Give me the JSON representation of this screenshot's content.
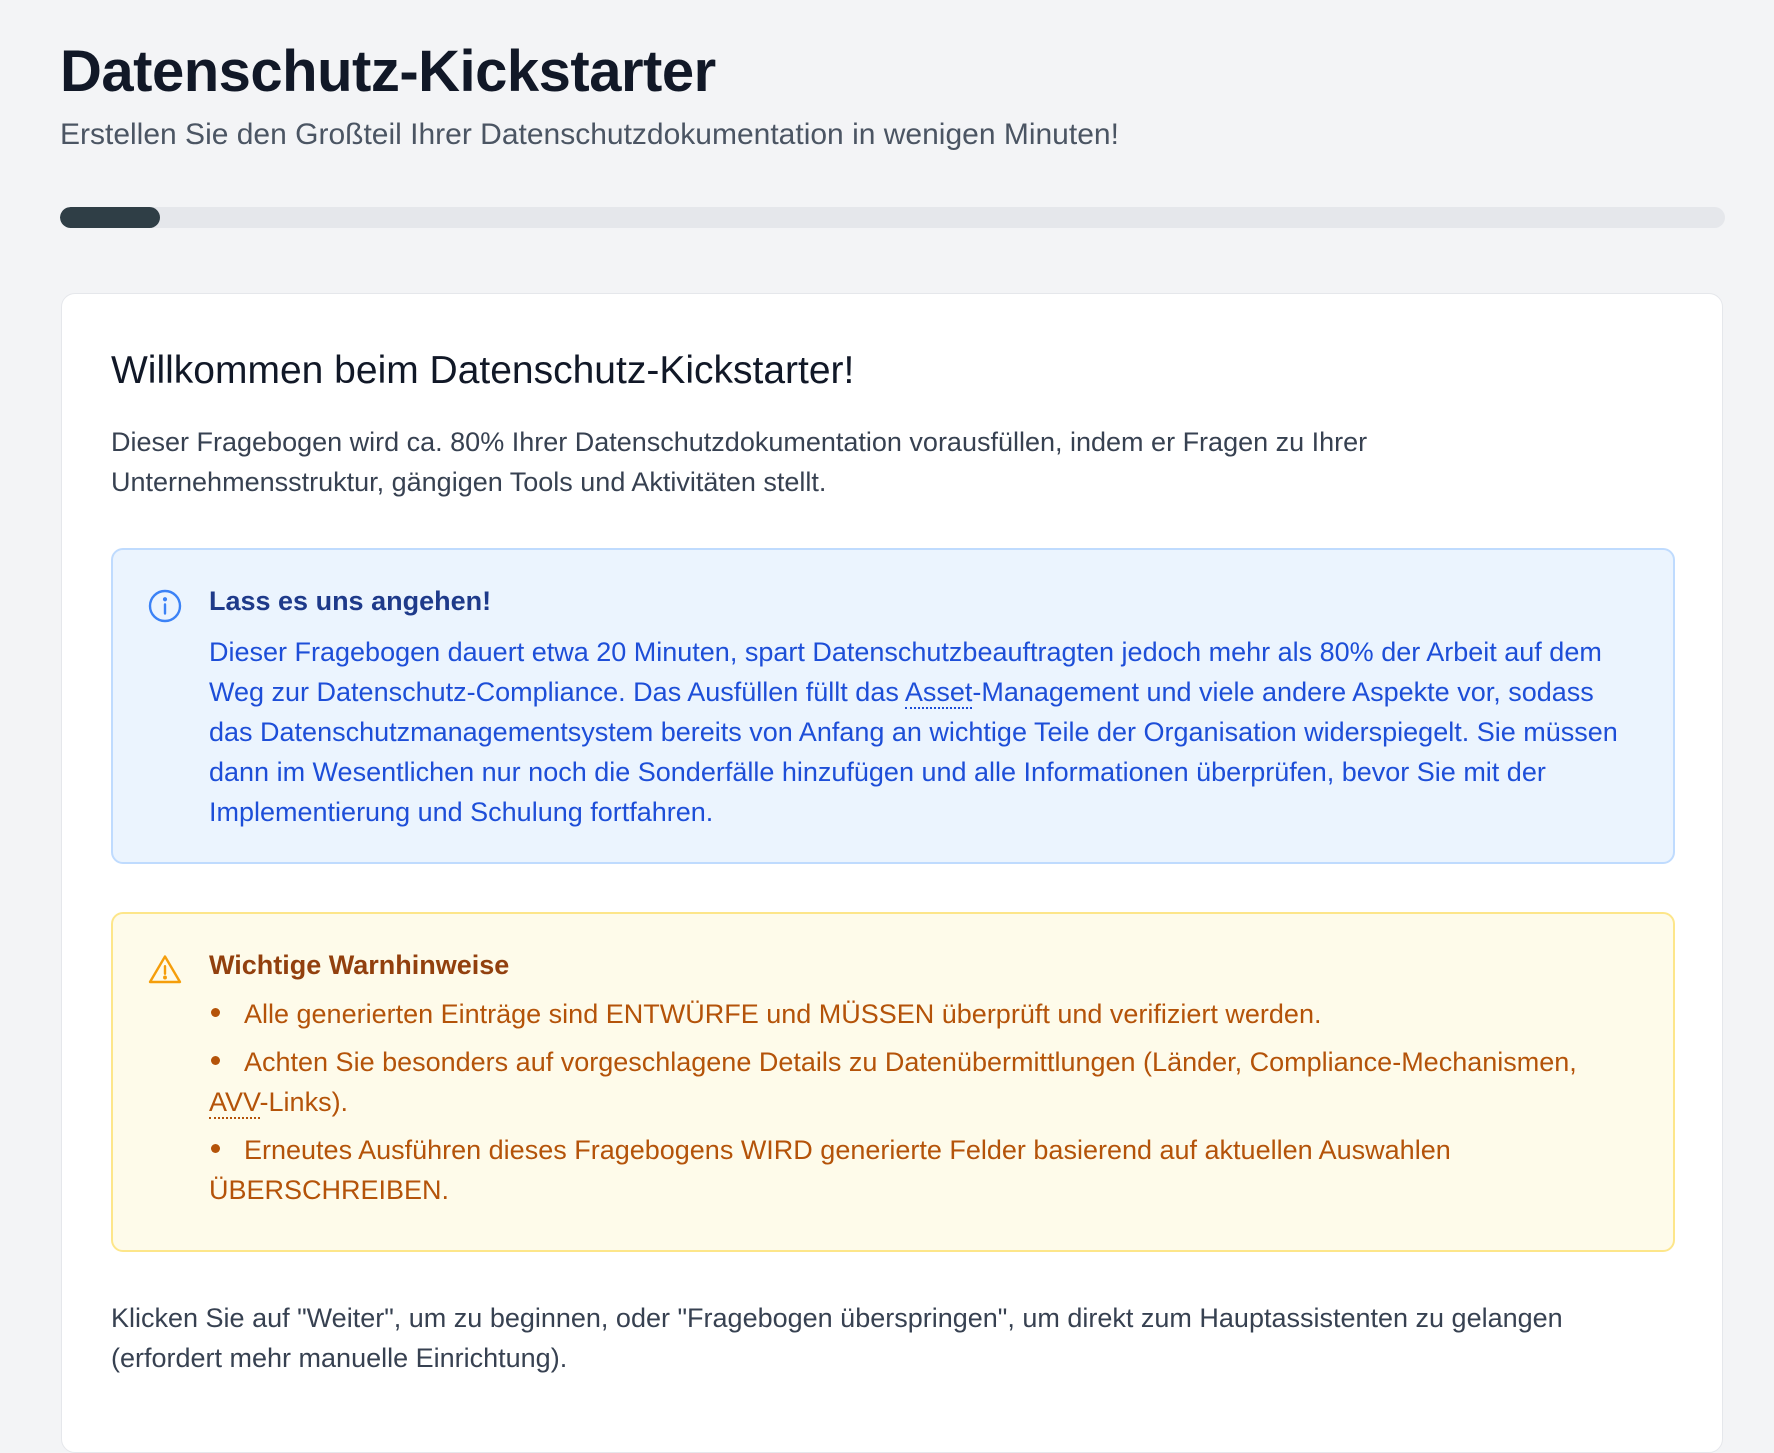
{
  "header": {
    "title": "Datenschutz-Kickstarter",
    "subtitle": "Erstellen Sie den Großteil Ihrer Datenschutzdokumentation in wenigen Minuten!"
  },
  "progress": {
    "fraction": 0.06
  },
  "card": {
    "heading": "Willkommen beim Datenschutz-Kickstarter!",
    "intro": "Dieser Fragebogen wird ca. 80% Ihrer Datenschutzdokumentation vorausfüllen, indem er Fragen zu Ihrer Unternehmensstruktur, gängigen Tools und Aktivitäten stellt.",
    "info": {
      "icon": "info-icon",
      "title": "Lass es uns angehen!",
      "text_before": "Dieser Fragebogen dauert etwa 20 Minuten, spart Datenschutzbeauftragten jedoch mehr als 80% der Arbeit auf dem Weg zur Datenschutz-Compliance. Das Ausfüllen füllt das ",
      "abbr": "Asset",
      "text_after": "-Management und viele andere Aspekte vor, sodass das Datenschutzmanagementsystem bereits von Anfang an wichtige Teile der Organisation widerspiegelt. Sie müssen dann im Wesentlichen nur noch die Sonderfälle hinzufügen und alle Informationen überprüfen, bevor Sie mit der Implementierung und Schulung fortfahren."
    },
    "warning": {
      "icon": "warning-icon",
      "title": "Wichtige Warnhinweise",
      "item1": "Alle generierten Einträge sind ENTWÜRFE und MÜSSEN überprüft und verifiziert werden.",
      "item2_before": "Achten Sie besonders auf vorgeschlagene Details zu Datenübermittlungen (Länder, Compliance-Mechanismen, ",
      "item2_abbr": "AVV",
      "item2_after": "-Links).",
      "item3": "Erneutes Ausführen dieses Fragebogens WIRD generierte Felder basierend auf aktuellen Auswahlen ÜBERSCHREIBEN."
    },
    "outro": "Klicken Sie auf \"Weiter\", um zu beginnen, oder \"Fragebogen überspringen\", um direkt zum Hauptassistenten zu gelangen (erfordert mehr manuelle Einrichtung)."
  },
  "colors": {
    "progress_fill": "#2f3e46",
    "info_text": "#1d4ed8",
    "warn_text": "#b45309"
  }
}
